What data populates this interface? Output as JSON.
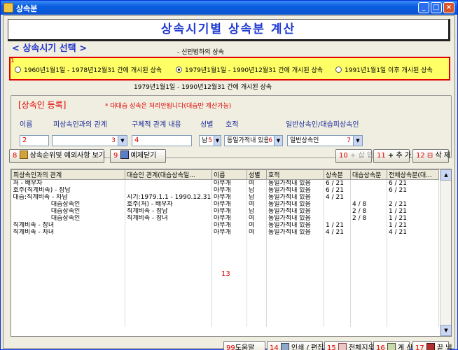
{
  "window": {
    "title": "상속분"
  },
  "banner": {
    "title": "상속시기별 상속분 계산"
  },
  "period": {
    "section_title": "< 상속시기  선택 >",
    "sub_caption": "- 신민법하의 상속",
    "box_num": "1",
    "options": [
      {
        "label": "1960년1월1일 - 1978년12월31  간에 개시된 상속",
        "selected": false
      },
      {
        "label": "1979년1월1일 - 1990년12월31  간에 개시된 상속",
        "selected": true
      },
      {
        "label": "1991년1월1일  이후 개시된 상속",
        "selected": false
      }
    ],
    "selected_caption": "1979년1월1일 - 1990년12월31  간에 개시된 상속"
  },
  "heir_form": {
    "title": "[상속인 등록]",
    "note": "* 대대습 상속은 처리안됩니다(대습만 계산가능)",
    "labels": {
      "name": "이름",
      "relation": "피상속인과의 관계",
      "detail": "구체적 관계 내용",
      "gender": "성별",
      "family_register": "호적",
      "heir_type": "일반상속인/대습피상속인"
    },
    "values": {
      "name": "2",
      "relation": "",
      "relation_num": "3",
      "detail": "4",
      "gender": "남",
      "gender_num": "5",
      "family_register": "동일가적내 있음",
      "family_register_num": "6",
      "heir_type": "일반상속인",
      "heir_type_num": "7"
    }
  },
  "buttons": {
    "order_view": {
      "num": "8",
      "label": "상속순위및 예외사항 보기"
    },
    "close_exceptions": {
      "num": "9",
      "label": "예제닫기"
    },
    "insert": {
      "num": "10",
      "label": "삽 입"
    },
    "add": {
      "num": "11",
      "label": "추 가"
    },
    "delete": {
      "num": "12",
      "label": "삭 제"
    }
  },
  "grid": {
    "columns": [
      "피상속인과의 관계",
      "대습인 관계(대습상속일...",
      "이름",
      "성별",
      "호적",
      "상속분",
      "대습상속분",
      "전체상속분(대..."
    ],
    "rows": [
      [
        "처 - 배우자",
        "",
        "아무개",
        "여",
        "동일가적내 있음",
        "6 / 21",
        "",
        "6 / 21"
      ],
      [
        "호주(직계비속) - 장남",
        "",
        "아무개",
        "남",
        "동일가적내 있음",
        "6 / 21",
        "",
        "6 / 21"
      ],
      [
        "대습:직계비속 - 차남",
        "시기:1979.1.1 - 1990.12.31",
        "아무개",
        "남",
        "동일가적내 있음",
        "4 / 21",
        "",
        ""
      ],
      [
        "                   대습상속인",
        "호주(처) - 배우자",
        "아무개",
        "여",
        "동일가적내 있음",
        "",
        "4 / 8",
        "2 / 21"
      ],
      [
        "                   대습상속인",
        "직계비속 - 장남",
        "아무개",
        "남",
        "동일가적내 있음",
        "",
        "2 / 8",
        "1 / 21"
      ],
      [
        "                   대습상속인",
        "직계비속 - 장녀",
        "아무개",
        "여",
        "동일가적내 있음",
        "",
        "2 / 8",
        "1 / 21"
      ],
      [
        "직계비속 - 장녀",
        "",
        "아무개",
        "여",
        "동일가적내 있음",
        "1 / 21",
        "",
        "1 / 21"
      ],
      [
        "직계비속 - 차녀",
        "",
        "아무개",
        "여",
        "동일가적내 있음",
        "4 / 21",
        "",
        "4 / 21"
      ]
    ],
    "overlay_num": "13"
  },
  "bottom_buttons": [
    {
      "num": "99",
      "label": "도움말"
    },
    {
      "num": "14",
      "label": "인쇄 / 편집"
    },
    {
      "num": "15",
      "label": "전체지우기"
    },
    {
      "num": "16",
      "label": "계 산"
    },
    {
      "num": "17",
      "label": "끝 냄"
    }
  ]
}
